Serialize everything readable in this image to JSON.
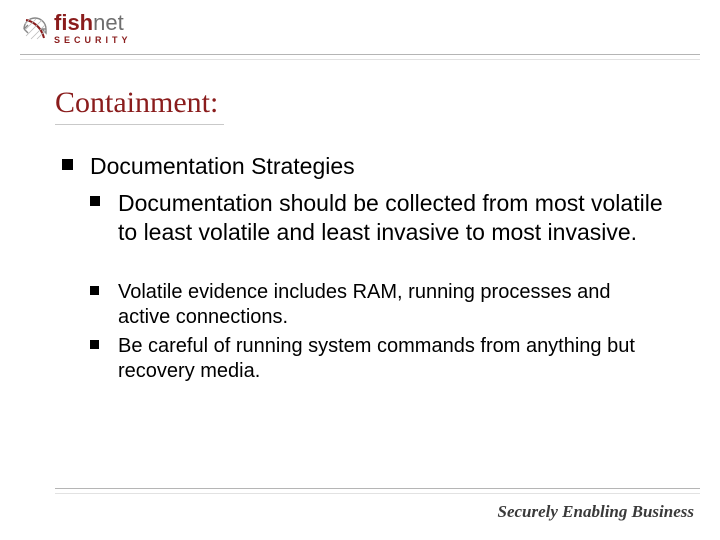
{
  "logo": {
    "brand_prefix": "fish",
    "brand_suffix": "net",
    "sub": "SECURITY"
  },
  "title": "Containment:",
  "bullets": {
    "main": "Documentation Strategies",
    "sub_big": "Documentation should be collected from most volatile to least volatile and least invasive to most invasive.",
    "sub_small_1": "Volatile evidence includes RAM, running processes and active connections.",
    "sub_small_2": "Be careful of running system commands from anything but recovery media."
  },
  "tagline": "Securely Enabling Business"
}
